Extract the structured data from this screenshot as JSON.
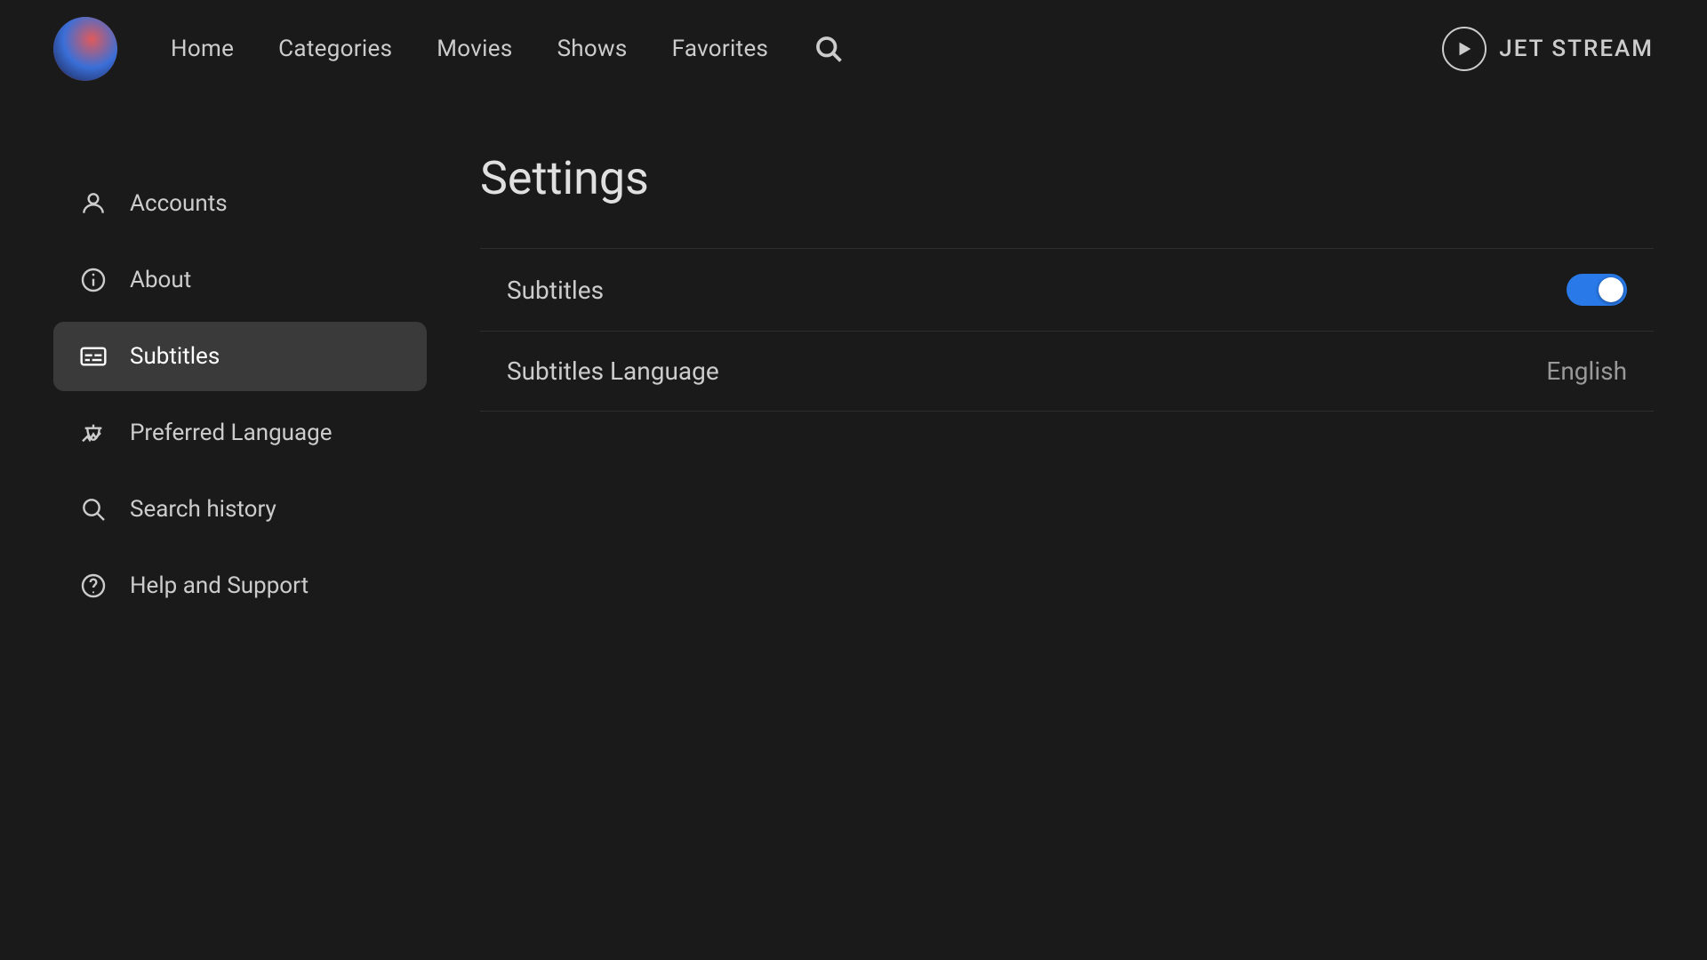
{
  "header": {
    "nav": {
      "home": "Home",
      "categories": "Categories",
      "movies": "Movies",
      "shows": "Shows",
      "favorites": "Favorites"
    },
    "brand": {
      "name": "JET STREAM"
    }
  },
  "sidebar": {
    "items": [
      {
        "id": "accounts",
        "label": "Accounts",
        "icon": "person-icon",
        "active": false
      },
      {
        "id": "about",
        "label": "About",
        "icon": "info-icon",
        "active": false
      },
      {
        "id": "subtitles",
        "label": "Subtitles",
        "icon": "subtitles-icon",
        "active": true
      },
      {
        "id": "preferred-language",
        "label": "Preferred Language",
        "icon": "translate-icon",
        "active": false
      },
      {
        "id": "search-history",
        "label": "Search history",
        "icon": "search-icon",
        "active": false
      },
      {
        "id": "help-support",
        "label": "Help and Support",
        "icon": "help-icon",
        "active": false
      }
    ]
  },
  "content": {
    "title": "Settings",
    "rows": [
      {
        "id": "subtitles-toggle",
        "label": "Subtitles",
        "type": "toggle",
        "value": true
      },
      {
        "id": "subtitles-language",
        "label": "Subtitles Language",
        "type": "value",
        "value": "English"
      }
    ]
  },
  "colors": {
    "accent": "#2979e8",
    "background": "#1a1a1a",
    "sidebar_active": "#3a3a3a"
  }
}
